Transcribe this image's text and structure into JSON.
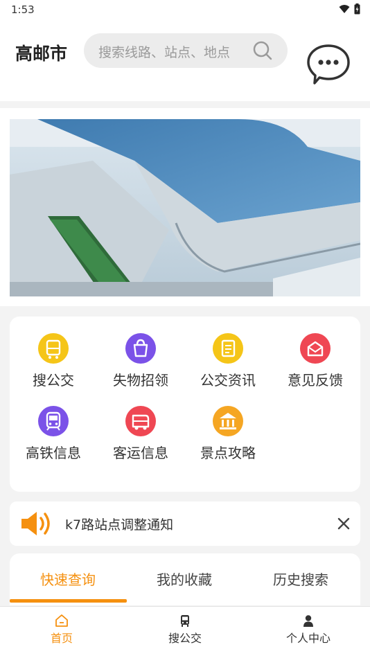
{
  "status": {
    "time": "1:53"
  },
  "header": {
    "city": "高邮市",
    "search_placeholder": "搜索线路、站点、地点"
  },
  "services": [
    {
      "label": "搜公交",
      "color": "#f5c518",
      "icon": "bus-card-icon"
    },
    {
      "label": "失物招领",
      "color": "#7b52e8",
      "icon": "bag-icon"
    },
    {
      "label": "公交资讯",
      "color": "#f5c518",
      "icon": "news-icon"
    },
    {
      "label": "意见反馈",
      "color": "#ef4753",
      "icon": "feedback-icon"
    },
    {
      "label": "高铁信息",
      "color": "#7b52e8",
      "icon": "train-icon"
    },
    {
      "label": "客运信息",
      "color": "#ef4753",
      "icon": "coach-icon"
    },
    {
      "label": "景点攻略",
      "color": "#f5a623",
      "icon": "landmark-icon"
    }
  ],
  "notice": {
    "text": "k7路站点调整通知"
  },
  "tabs": [
    {
      "label": "快速查询",
      "active": true
    },
    {
      "label": "我的收藏",
      "active": false
    },
    {
      "label": "历史搜索",
      "active": false
    }
  ],
  "bottom_nav": [
    {
      "label": "首页",
      "active": true,
      "icon": "home-icon"
    },
    {
      "label": "搜公交",
      "active": false,
      "icon": "bus-icon"
    },
    {
      "label": "个人中心",
      "active": false,
      "icon": "user-icon"
    }
  ],
  "colors": {
    "accent": "#f5900f"
  }
}
